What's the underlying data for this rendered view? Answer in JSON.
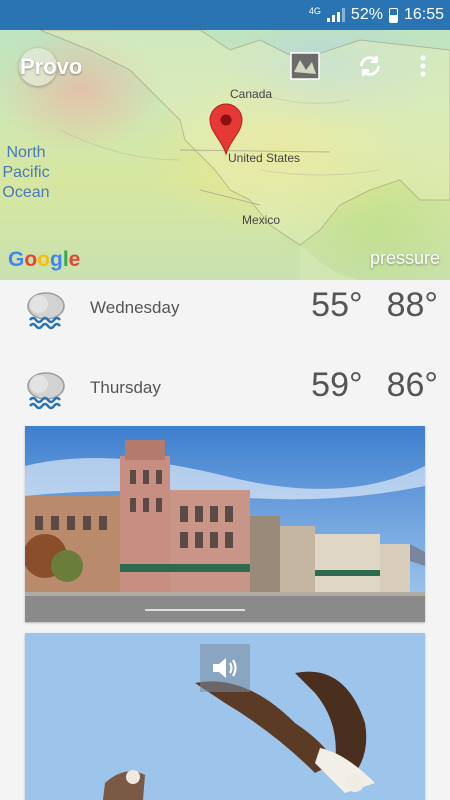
{
  "status_bar": {
    "network": "4G",
    "battery": "52%",
    "time": "16:55"
  },
  "map": {
    "title": "Provo",
    "labels": {
      "canada": "Canada",
      "united_states": "United States",
      "mexico": "Mexico",
      "ocean_line1": "North",
      "ocean_line2": "Pacific",
      "ocean_line3": "Ocean"
    },
    "google": "Google",
    "layer": "pressure",
    "icons": [
      "map-layer-icon",
      "refresh-icon",
      "more-vert-icon",
      "location-pin-icon"
    ]
  },
  "forecast": [
    {
      "day": "Wednesday",
      "low": "55°",
      "high": "88°",
      "icon": "rain-cloud-icon"
    },
    {
      "day": "Thursday",
      "low": "59°",
      "high": "86°",
      "icon": "rain-cloud-icon"
    }
  ],
  "colors": {
    "status_bar": "#2a74b3",
    "pin": "#e53935",
    "background": "#f4f4f4",
    "text": "#555555",
    "ocean_label": "#4a78b8"
  }
}
